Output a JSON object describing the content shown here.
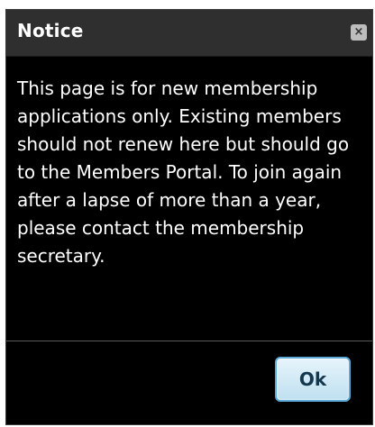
{
  "dialog": {
    "title": "Notice",
    "close_label": "×",
    "message": "This page is for new membership applications only. Existing members should not renew here but should go to the Members Portal. To join again after a lapse of more than a year, please contact the membership secretary.",
    "ok_label": "Ok"
  },
  "icons": {
    "close": "close-icon"
  },
  "colors": {
    "dialog_background": "#000000",
    "titlebar_background": "#2f2f2f",
    "ok_button_border": "#5aa9d6"
  }
}
